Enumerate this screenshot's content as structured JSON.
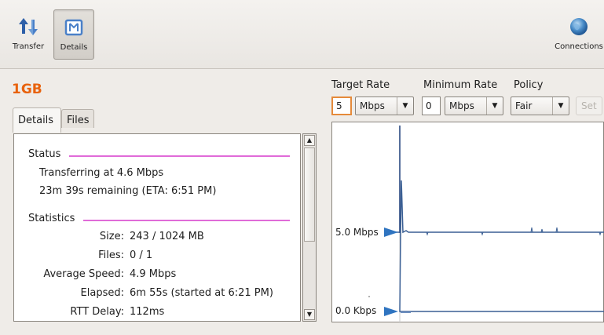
{
  "toolbar": {
    "transfer_label": "Transfer",
    "details_label": "Details",
    "connections_label": "Connections"
  },
  "title": "1GB",
  "tabs": [
    "Details",
    "Files"
  ],
  "status": {
    "heading": "Status",
    "line1": "Transferring at 4.6 Mbps",
    "line2": "23m 39s remaining (ETA: 6:51 PM)"
  },
  "statistics": {
    "heading": "Statistics",
    "rows": [
      {
        "label": "Size:",
        "value": "243 / 1024 MB"
      },
      {
        "label": "Files:",
        "value": "0 / 1"
      },
      {
        "label": "Average Speed:",
        "value": "4.9 Mbps"
      },
      {
        "label": "Elapsed:",
        "value": "6m 55s (started at 6:21 PM)"
      },
      {
        "label": "RTT Delay:",
        "value": "112ms"
      }
    ]
  },
  "controls": {
    "target_rate_label": "Target Rate",
    "minimum_rate_label": "Minimum Rate",
    "policy_label": "Policy",
    "target_rate_value": "5",
    "target_rate_unit": "Mbps",
    "minimum_rate_value": "0",
    "minimum_rate_unit": "Mbps",
    "policy_value": "Fair",
    "set_label": "Set"
  },
  "graph": {
    "upper_marker_label": "5.0 Mbps",
    "lower_marker_label": "0.0 Kbps"
  },
  "colors": {
    "title": "#e8620d",
    "section_line": "#e06bd8",
    "graph_line": "#3a5f94",
    "marker": "#2f74c0"
  }
}
